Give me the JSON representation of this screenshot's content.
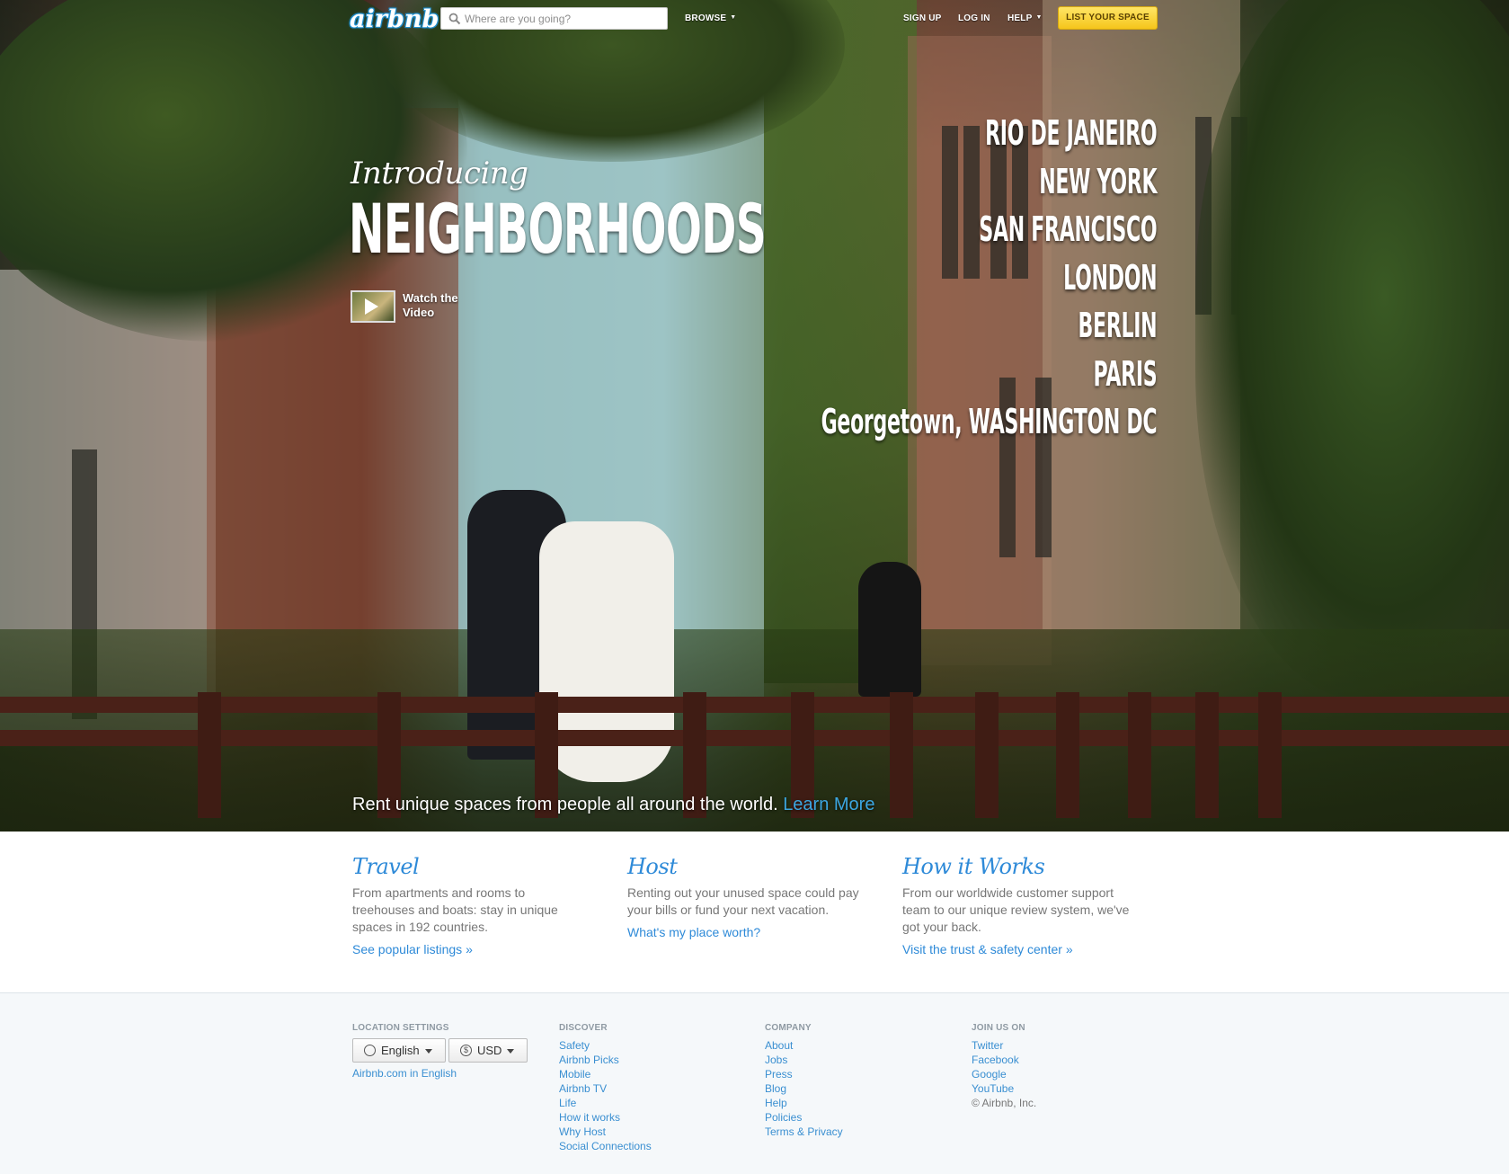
{
  "nav": {
    "logo": "airbnb",
    "search_placeholder": "Where are you going?",
    "browse": "BROWSE",
    "sign_up": "SIGN UP",
    "log_in": "LOG IN",
    "help": "HELP",
    "list_your_space": "LIST YOUR SPACE"
  },
  "hero": {
    "intro": "Introducing",
    "headline": "NEIGHBORHOODS",
    "watch_video": "Watch the Video",
    "cities": [
      "RIO DE JANEIRO",
      "NEW YORK",
      "SAN FRANCISCO",
      "LONDON",
      "BERLIN",
      "PARIS",
      "Georgetown, WASHINGTON DC"
    ],
    "tagline": "Rent unique spaces from people all around the world.",
    "learn_more": "Learn More"
  },
  "features": [
    {
      "title": "Travel",
      "description": "From apartments and rooms to treehouses and boats: stay in unique spaces in 192 countries.",
      "link": "See popular listings »"
    },
    {
      "title": "Host",
      "description": "Renting out your unused space could pay your bills or fund your next vacation.",
      "link": "What's my place worth?"
    },
    {
      "title": "How it Works",
      "description": "From our worldwide customer support team to our unique review system, we've got your back.",
      "link": "Visit the trust & safety center »"
    }
  ],
  "footer": {
    "location": {
      "heading": "LOCATION SETTINGS",
      "language": "English",
      "currency": "USD",
      "site_link": "Airbnb.com in English"
    },
    "discover": {
      "heading": "DISCOVER",
      "links": [
        "Safety",
        "Airbnb Picks",
        "Mobile",
        "Airbnb TV",
        "Life",
        "How it works",
        "Why Host",
        "Social Connections"
      ]
    },
    "company": {
      "heading": "COMPANY",
      "links": [
        "About",
        "Jobs",
        "Press",
        "Blog",
        "Help",
        "Policies",
        "Terms & Privacy"
      ]
    },
    "join": {
      "heading": "JOIN US ON",
      "links": [
        "Twitter",
        "Facebook",
        "Google",
        "YouTube"
      ],
      "copyright": "© Airbnb, Inc."
    }
  },
  "icons": {
    "search": "search-icon",
    "play": "play-icon",
    "globe": "globe-icon",
    "currency": "dollar-icon",
    "caret": "chevron-down-icon"
  },
  "colors": {
    "link_blue": "#2e8ad8",
    "learn_more": "#3ca6e0",
    "cta_yellow": "#f5c51b",
    "footer_bg": "#f5f8fa"
  }
}
